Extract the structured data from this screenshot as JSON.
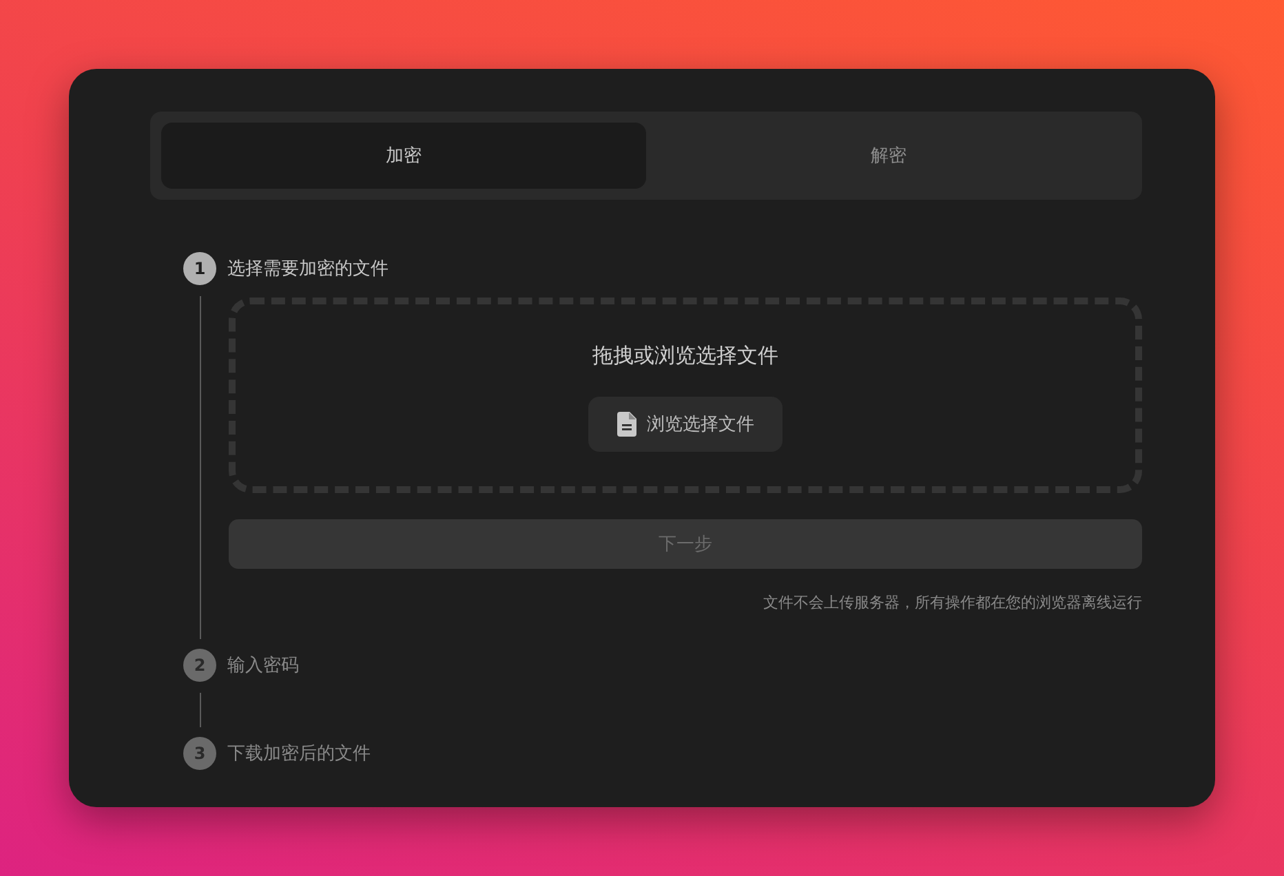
{
  "tabs": [
    {
      "label": "加密",
      "selected": true
    },
    {
      "label": "解密",
      "selected": false
    }
  ],
  "steps": [
    {
      "number": "1",
      "title": "选择需要加密的文件",
      "active": true
    },
    {
      "number": "2",
      "title": "输入密码",
      "active": false
    },
    {
      "number": "3",
      "title": "下载加密后的文件",
      "active": false
    }
  ],
  "dropzone": {
    "prompt": "拖拽或浏览选择文件",
    "browse_button": "浏览选择文件"
  },
  "next_button": {
    "label": "下一步",
    "disabled": true
  },
  "note": "文件不会上传服务器，所有操作都在您的浏览器离线运行"
}
